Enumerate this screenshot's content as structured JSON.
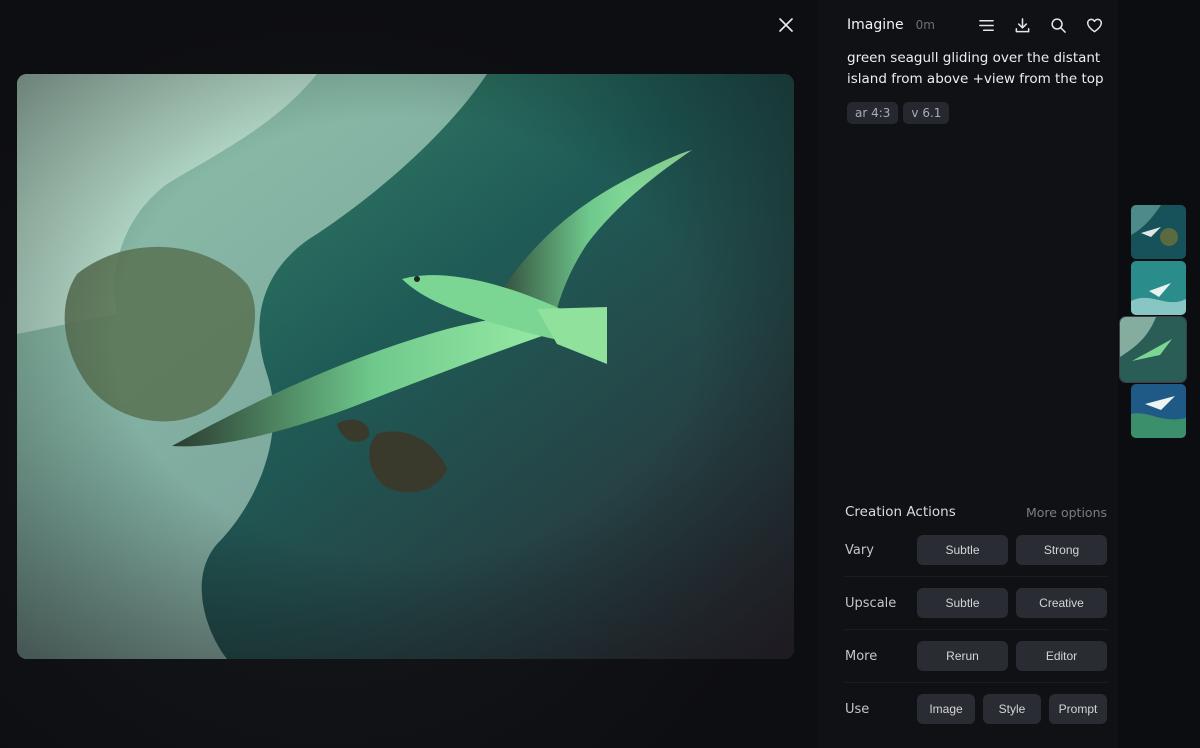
{
  "header": {
    "title": "Imagine",
    "time": "0m"
  },
  "icons": {
    "close": "close-icon",
    "menu": "menu-lines-icon",
    "download": "download-icon",
    "search": "search-icon",
    "like": "heart-icon"
  },
  "prompt": {
    "text": "green seagull gliding over the distant island from above +view from the top",
    "params": [
      "ar 4:3",
      "v 6.1"
    ]
  },
  "actions": {
    "title": "Creation Actions",
    "more_options": "More options",
    "rows": [
      {
        "label": "Vary",
        "buttons": [
          "Subtle",
          "Strong"
        ]
      },
      {
        "label": "Upscale",
        "buttons": [
          "Subtle",
          "Creative"
        ]
      },
      {
        "label": "More",
        "buttons": [
          "Rerun",
          "Editor"
        ]
      },
      {
        "label": "Use",
        "buttons": [
          "Image",
          "Style",
          "Prompt"
        ]
      }
    ]
  },
  "colors": {
    "background": "#0c0d10",
    "panel": "#101115",
    "button": "#2a2c33",
    "chip": "#262830"
  }
}
